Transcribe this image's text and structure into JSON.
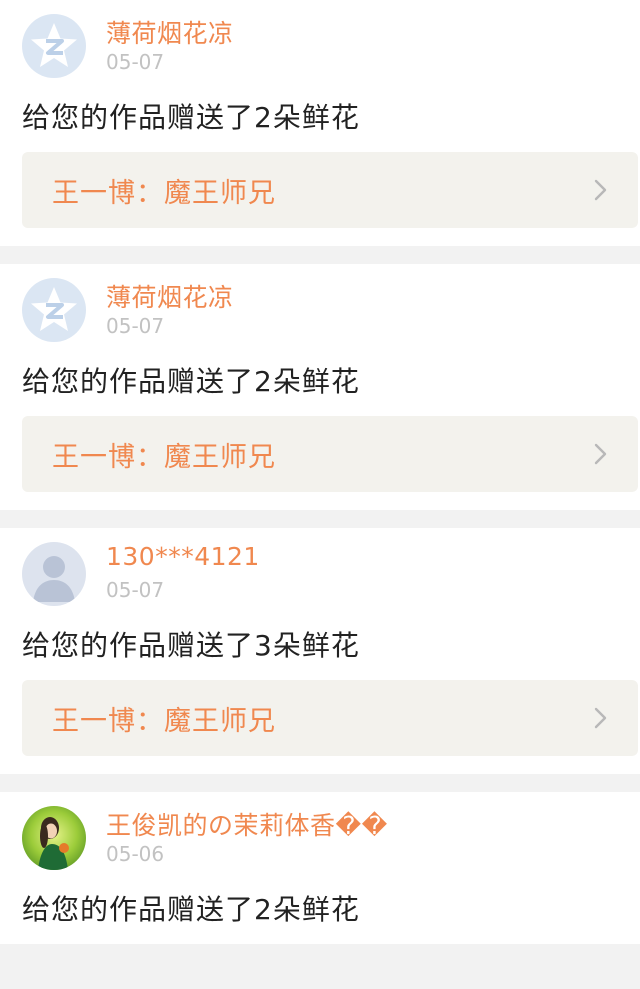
{
  "feed": [
    {
      "user_name": "薄荷烟花凉",
      "date": "05-07",
      "avatar_type": "qzone-default",
      "message": "给您的作品赠送了2朵鲜花",
      "work_title": "王一博：魔王师兄"
    },
    {
      "user_name": "薄荷烟花凉",
      "date": "05-07",
      "avatar_type": "qzone-default",
      "message": "给您的作品赠送了2朵鲜花",
      "work_title": "王一博：魔王师兄"
    },
    {
      "user_name": "130***4121",
      "date": "05-07",
      "avatar_type": "person-placeholder",
      "message": "给您的作品赠送了3朵鲜花",
      "work_title": "王一博：魔王师兄"
    },
    {
      "user_name": "王俊凯的の茉莉体香��",
      "date": "05-06",
      "avatar_type": "photo-girl-green",
      "message": "给您的作品赠送了2朵鲜花"
    }
  ],
  "colors": {
    "accent": "#f0884f",
    "date": "#c2c2c2",
    "work_bg": "#f3f2ed",
    "page_bg": "#f2f2f2"
  },
  "icons": {
    "chevron": "chevron-right-icon"
  }
}
